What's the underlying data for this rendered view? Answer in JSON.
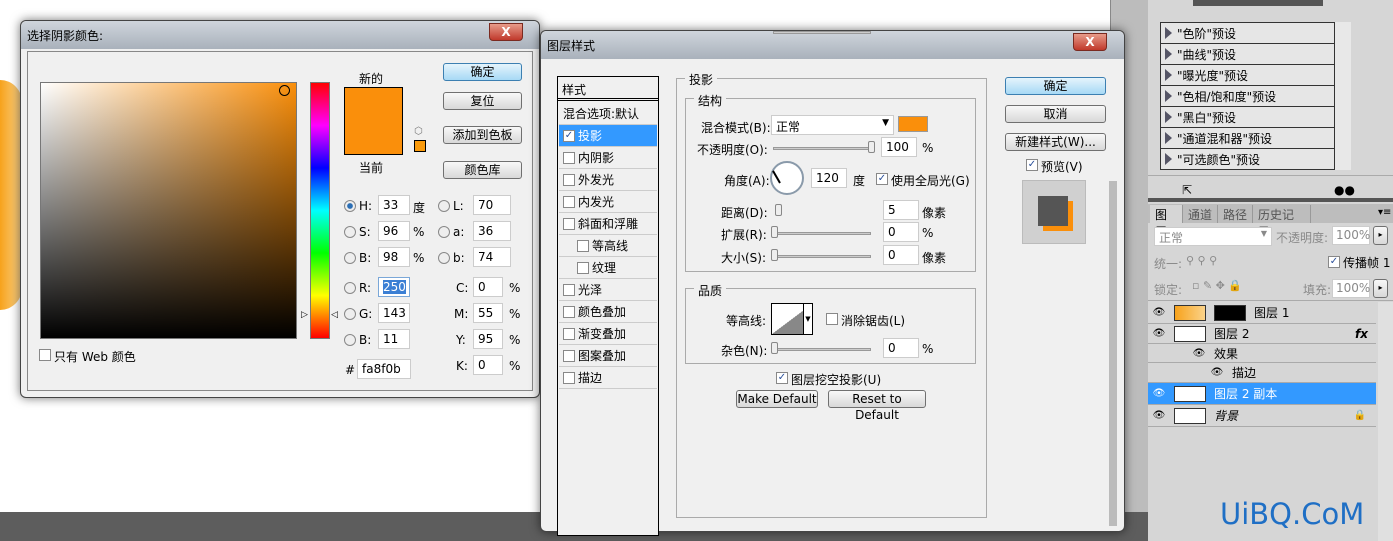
{
  "color_picker": {
    "title": "选择阴影颜色:",
    "close": "X",
    "new_label": "新的",
    "current_label": "当前",
    "buttons": {
      "ok": "确定",
      "reset": "复位",
      "add_swatch": "添加到色板",
      "libraries": "颜色库"
    },
    "fields": {
      "H": {
        "label": "H:",
        "value": "33",
        "unit": "度"
      },
      "S": {
        "label": "S:",
        "value": "96",
        "unit": "%"
      },
      "B": {
        "label": "B:",
        "value": "98",
        "unit": "%"
      },
      "R": {
        "label": "R:",
        "value": "250"
      },
      "G": {
        "label": "G:",
        "value": "143"
      },
      "Bb": {
        "label": "B:",
        "value": "11"
      },
      "L": {
        "label": "L:",
        "value": "70"
      },
      "a": {
        "label": "a:",
        "value": "36"
      },
      "b": {
        "label": "b:",
        "value": "74"
      },
      "C": {
        "label": "C:",
        "value": "0",
        "unit": "%"
      },
      "M": {
        "label": "M:",
        "value": "55",
        "unit": "%"
      },
      "Y": {
        "label": "Y:",
        "value": "95",
        "unit": "%"
      },
      "K": {
        "label": "K:",
        "value": "0",
        "unit": "%"
      }
    },
    "hash": "#",
    "hex": "fa8f0b",
    "web_only": "只有 Web 颜色",
    "color": "#fa8f0b"
  },
  "layer_style": {
    "title": "图层样式",
    "close": "X",
    "styles_header": "样式",
    "blend_options": "混合选项:默认",
    "styles": [
      {
        "label": "投影",
        "checked": true,
        "selected": true
      },
      {
        "label": "内阴影"
      },
      {
        "label": "外发光"
      },
      {
        "label": "内发光"
      },
      {
        "label": "斜面和浮雕"
      },
      {
        "label": "等高线",
        "sub": true
      },
      {
        "label": "纹理",
        "sub": true
      },
      {
        "label": "光泽"
      },
      {
        "label": "颜色叠加"
      },
      {
        "label": "渐变叠加"
      },
      {
        "label": "图案叠加"
      },
      {
        "label": "描边"
      }
    ],
    "section": "投影",
    "structure": "结构",
    "blend_mode_label": "混合模式(B):",
    "blend_mode": "正常",
    "opacity_label": "不透明度(O):",
    "opacity": "100",
    "pct": "%",
    "angle_label": "角度(A):",
    "angle": "120",
    "deg": "度",
    "global_light": "使用全局光(G)",
    "distance_label": "距离(D):",
    "distance": "5",
    "px": "像素",
    "spread_label": "扩展(R):",
    "spread": "0",
    "size_label": "大小(S):",
    "size": "0",
    "quality": "品质",
    "contour_label": "等高线:",
    "anti_alias": "消除锯齿(L)",
    "noise_label": "杂色(N):",
    "noise": "0",
    "knockout": "图层挖空投影(U)",
    "make_default": "Make Default",
    "reset_default": "Reset to Default",
    "buttons": {
      "ok": "确定",
      "cancel": "取消",
      "new_style": "新建样式(W)..."
    },
    "preview": "预览(V)"
  },
  "panel": {
    "adjustments": [
      "\"色阶\"预设",
      "\"曲线\"预设",
      "\"曝光度\"预设",
      "\"色相/饱和度\"预设",
      "\"黑白\"预设",
      "\"通道混和器\"预设",
      "\"可选颜色\"预设"
    ],
    "tabs": [
      "图层",
      "通道",
      "路径",
      "历史记录"
    ],
    "blend": "正常",
    "opacity_label": "不透明度:",
    "opacity": "100%",
    "unify": "统一:",
    "propagate": "传播帧 1",
    "lock": "锁定:",
    "fill_label": "填充:",
    "fill": "100%",
    "layers": [
      {
        "name": "图层 1"
      },
      {
        "name": "图层 2",
        "fx": "fx"
      },
      {
        "name": "效果"
      },
      {
        "name": "描边"
      },
      {
        "name": "图层 2 副本",
        "selected": true
      },
      {
        "name": "背景"
      }
    ]
  },
  "watermark": "UiBQ.CoM"
}
